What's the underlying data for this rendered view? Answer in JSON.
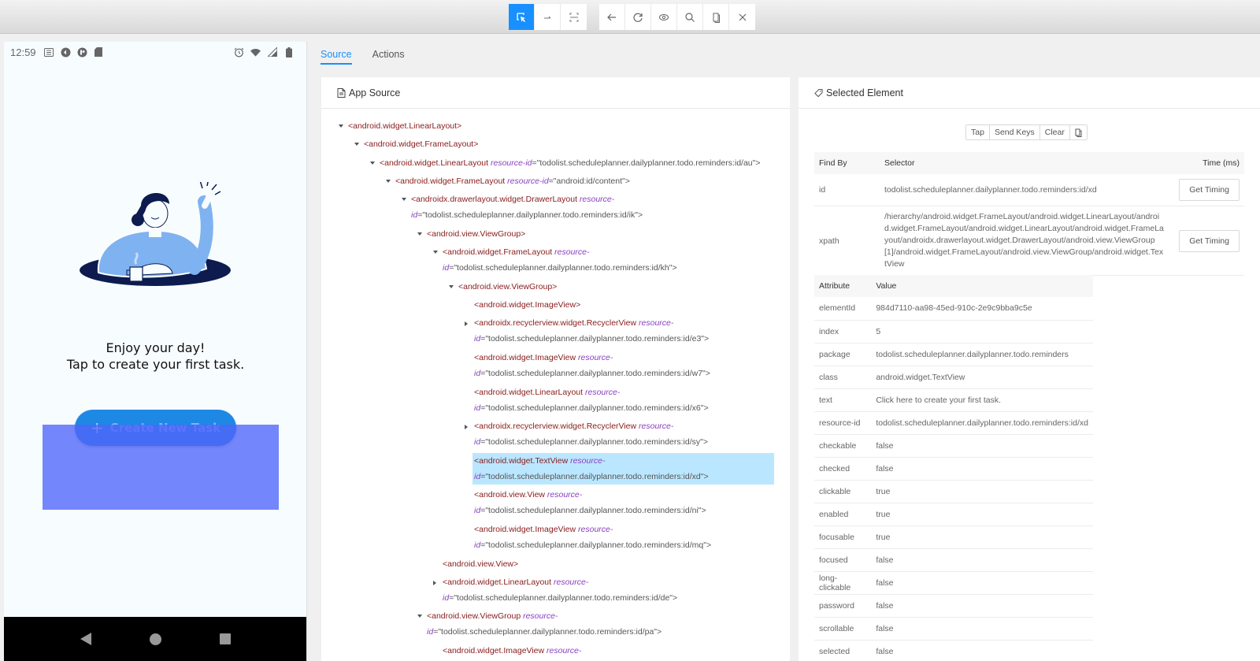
{
  "toolbar": {
    "group1": [
      {
        "name": "select-elements-button",
        "icon": "cursor-select-icon",
        "active": true
      },
      {
        "name": "swipe-button",
        "icon": "swipe-arrow-icon",
        "active": false
      },
      {
        "name": "tap-by-coordinates-button",
        "icon": "crop-frame-icon",
        "active": false
      }
    ],
    "group2": [
      {
        "name": "back-button",
        "icon": "arrow-left-icon"
      },
      {
        "name": "refresh-button",
        "icon": "refresh-icon"
      },
      {
        "name": "show-hide-button",
        "icon": "eye-icon"
      },
      {
        "name": "search-button",
        "icon": "search-icon"
      },
      {
        "name": "copy-xml-button",
        "icon": "copy-icon"
      },
      {
        "name": "quit-button",
        "icon": "close-icon"
      }
    ]
  },
  "phone": {
    "status_time": "12:59",
    "status_left_icons": [
      "notes-icon",
      "sync-icon",
      "app-icon",
      "sd-card-icon"
    ],
    "status_right_icons": [
      "alarm-icon",
      "wifi-icon",
      "signal-icon",
      "battery-icon"
    ],
    "message_line1": "Enjoy your day!",
    "message_line2": "Tap to create your first task.",
    "create_button_plus": "+",
    "create_button_label": "Create New Task",
    "accent_color": "#1e88e5",
    "highlight_color": "#5064fa"
  },
  "tabs": [
    {
      "label": "Source",
      "active": true
    },
    {
      "label": "Actions",
      "active": false
    }
  ],
  "source_panel": {
    "title": "App Source",
    "tree": [
      {
        "depth": 0,
        "caret": "open",
        "tag": "<android.widget.LinearLayout>"
      },
      {
        "depth": 1,
        "caret": "open",
        "tag": "<android.widget.FrameLayout>"
      },
      {
        "depth": 2,
        "caret": "open",
        "tag": "<android.widget.LinearLayout",
        "attr": "resource-id",
        "value": "=\"todolist.scheduleplanner.dailyplanner.todo.reminders:id/au\">",
        "wrap": false
      },
      {
        "depth": 3,
        "caret": "open",
        "tag": "<android.widget.FrameLayout",
        "attr": "resource-id",
        "value": "=\"android:id/content\">",
        "wrap": false
      },
      {
        "depth": 4,
        "caret": "open",
        "tag": "<androidx.drawerlayout.widget.DrawerLayout",
        "attr": "resource-",
        "attr2": "id",
        "value": "=\"todolist.scheduleplanner.dailyplanner.todo.reminders:id/ik\">",
        "wrap": true
      },
      {
        "depth": 5,
        "caret": "open",
        "tag": "<android.view.ViewGroup>"
      },
      {
        "depth": 6,
        "caret": "open",
        "tag": "<android.widget.FrameLayout",
        "attr": "resource-",
        "attr2": "id",
        "value": "=\"todolist.scheduleplanner.dailyplanner.todo.reminders:id/kh\">",
        "wrap": true
      },
      {
        "depth": 7,
        "caret": "open",
        "tag": "<android.view.ViewGroup>"
      },
      {
        "depth": 8,
        "caret": "none",
        "tag": "<android.widget.ImageView>"
      },
      {
        "depth": 8,
        "caret": "closed",
        "tag": "<androidx.recyclerview.widget.RecyclerView",
        "attr": "resource-",
        "attr2": "id",
        "value": "=\"todolist.scheduleplanner.dailyplanner.todo.reminders:id/e3\">",
        "wrap": true
      },
      {
        "depth": 8,
        "caret": "none",
        "tag": "<android.widget.ImageView",
        "attr": "resource-",
        "attr2": "id",
        "value": "=\"todolist.scheduleplanner.dailyplanner.todo.reminders:id/w7\">",
        "wrap": true
      },
      {
        "depth": 8,
        "caret": "none",
        "tag": "<android.widget.LinearLayout",
        "attr": "resource-",
        "attr2": "id",
        "value": "=\"todolist.scheduleplanner.dailyplanner.todo.reminders:id/x6\">",
        "wrap": true
      },
      {
        "depth": 8,
        "caret": "closed",
        "tag": "<androidx.recyclerview.widget.RecyclerView",
        "attr": "resource-",
        "attr2": "id",
        "value": "=\"todolist.scheduleplanner.dailyplanner.todo.reminders:id/sy\">",
        "wrap": true
      },
      {
        "depth": 8,
        "caret": "none",
        "tag": "<android.widget.TextView",
        "attr": "resource-",
        "attr2": "id",
        "value": "=\"todolist.scheduleplanner.dailyplanner.todo.reminders:id/xd\">",
        "wrap": true,
        "selected": true
      },
      {
        "depth": 8,
        "caret": "none",
        "tag": "<android.view.View",
        "attr": "resource-",
        "attr2": "id",
        "value": "=\"todolist.scheduleplanner.dailyplanner.todo.reminders:id/ni\">",
        "wrap": true
      },
      {
        "depth": 8,
        "caret": "none",
        "tag": "<android.widget.ImageView",
        "attr": "resource-",
        "attr2": "id",
        "value": "=\"todolist.scheduleplanner.dailyplanner.todo.reminders:id/mq\">",
        "wrap": true
      },
      {
        "depth": 6,
        "caret": "none",
        "tag": "<android.view.View>"
      },
      {
        "depth": 6,
        "caret": "closed",
        "tag": "<android.widget.LinearLayout",
        "attr": "resource-",
        "attr2": "id",
        "value": "=\"todolist.scheduleplanner.dailyplanner.todo.reminders:id/de\">",
        "wrap": true
      },
      {
        "depth": 5,
        "caret": "open",
        "tag": "<android.view.ViewGroup",
        "attr": "resource-",
        "attr2": "id",
        "value": "=\"todolist.scheduleplanner.dailyplanner.todo.reminders:id/pa\">",
        "wrap": true
      },
      {
        "depth": 6,
        "caret": "none",
        "tag": "<android.widget.ImageView",
        "attr": "resource-",
        "wrap": false
      }
    ]
  },
  "selected_panel": {
    "title": "Selected Element",
    "actions": [
      "Tap",
      "Send Keys",
      "Clear"
    ],
    "copy_icon": "copy-icon",
    "findby_headers": [
      "Find By",
      "Selector",
      "Time (ms)"
    ],
    "findby_rows": [
      {
        "by": "id",
        "selector": "todolist.scheduleplanner.dailyplanner.todo.reminders:id/xd",
        "button": "Get Timing"
      },
      {
        "by": "xpath",
        "selector": "/hierarchy/android.widget.FrameLayout/android.widget.LinearLayout/android.widget.FrameLayout/android.widget.LinearLayout/android.widget.FrameLayout/androidx.drawerlayout.widget.DrawerLayout/android.view.ViewGroup[1]/android.widget.FrameLayout/android.view.ViewGroup/android.widget.TextView",
        "button": "Get Timing"
      }
    ],
    "attr_headers": [
      "Attribute",
      "Value"
    ],
    "attributes": [
      {
        "k": "elementId",
        "v": "984d7110-aa98-45ed-910c-2e9c9bba9c5e"
      },
      {
        "k": "index",
        "v": "5"
      },
      {
        "k": "package",
        "v": "todolist.scheduleplanner.dailyplanner.todo.reminders"
      },
      {
        "k": "class",
        "v": "android.widget.TextView"
      },
      {
        "k": "text",
        "v": "Click here to create your first task."
      },
      {
        "k": "resource-id",
        "v": "todolist.scheduleplanner.dailyplanner.todo.reminders:id/xd"
      },
      {
        "k": "checkable",
        "v": "false"
      },
      {
        "k": "checked",
        "v": "false"
      },
      {
        "k": "clickable",
        "v": "true"
      },
      {
        "k": "enabled",
        "v": "true"
      },
      {
        "k": "focusable",
        "v": "true"
      },
      {
        "k": "focused",
        "v": "false"
      },
      {
        "k": "long-clickable",
        "v": "false"
      },
      {
        "k": "password",
        "v": "false"
      },
      {
        "k": "scrollable",
        "v": "false"
      },
      {
        "k": "selected",
        "v": "false"
      }
    ]
  }
}
